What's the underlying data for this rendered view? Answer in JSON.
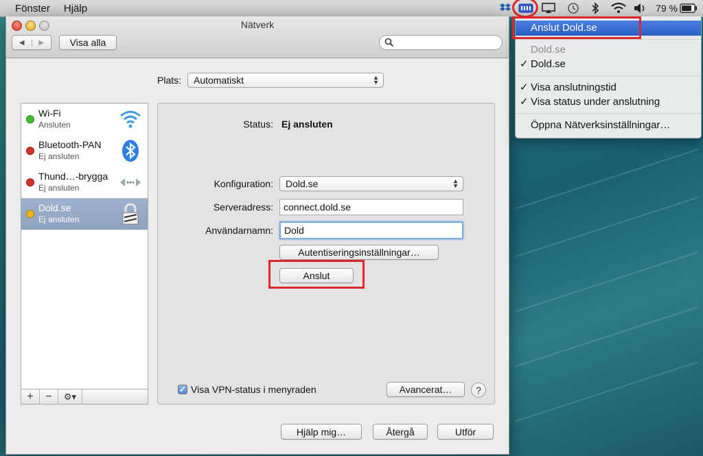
{
  "menubar": {
    "items": [
      "Fönster",
      "Hjälp"
    ],
    "battery_label": "79 %"
  },
  "window": {
    "title": "Nätverk",
    "show_all_label": "Visa alla",
    "search_placeholder": ""
  },
  "location": {
    "label": "Plats:",
    "value": "Automatiskt"
  },
  "services": [
    {
      "name": "Wi-Fi",
      "status": "Ansluten",
      "dot": "#3fbf2a",
      "icon": "wifi-icon"
    },
    {
      "name": "Bluetooth-PAN",
      "status": "Ej ansluten",
      "dot": "#d93028",
      "icon": "bluetooth-icon"
    },
    {
      "name": "Thund…-brygga",
      "status": "Ej ansluten",
      "dot": "#d93028",
      "icon": "thunderbolt-bridge-icon"
    },
    {
      "name": "Dold.se",
      "status": "Ej ansluten",
      "dot": "#f0b61f",
      "icon": "vpn-lock-icon"
    }
  ],
  "list_toolbar": {
    "add": "+",
    "remove": "−",
    "gear": "⚙▾"
  },
  "detail": {
    "status_label": "Status:",
    "status_value": "Ej ansluten",
    "config_label": "Konfiguration:",
    "config_value": "Dold.se",
    "server_label": "Serveradress:",
    "server_value": "connect.dold.se",
    "user_label": "Användarnamn:",
    "user_value": "Dold",
    "auth_button": "Autentiseringsinställningar…",
    "connect_button": "Anslut",
    "vpn_status_checkbox": "Visa VPN-status i menyraden",
    "advanced_button": "Avancerat…",
    "help_button": "?"
  },
  "footer": {
    "help_me": "Hjälp mig…",
    "revert": "Återgå",
    "apply": "Utför"
  },
  "vpn_menu": {
    "items": [
      {
        "label": "Anslut Dold.se",
        "state": "active"
      },
      {
        "label": "Dold.se",
        "state": "disabled"
      },
      {
        "label": "Dold.se",
        "state": "checked"
      },
      {
        "label": "Visa anslutningstid",
        "state": "checked"
      },
      {
        "label": "Visa status under anslutning",
        "state": "checked"
      },
      {
        "label": "Öppna Nätverksinställningar…",
        "state": "normal"
      }
    ],
    "check_mark": "✓"
  },
  "colors": {
    "highlight_red": "#e0262a",
    "menu_selection": "#2f63cc",
    "selected_row": "#95a9c5"
  }
}
